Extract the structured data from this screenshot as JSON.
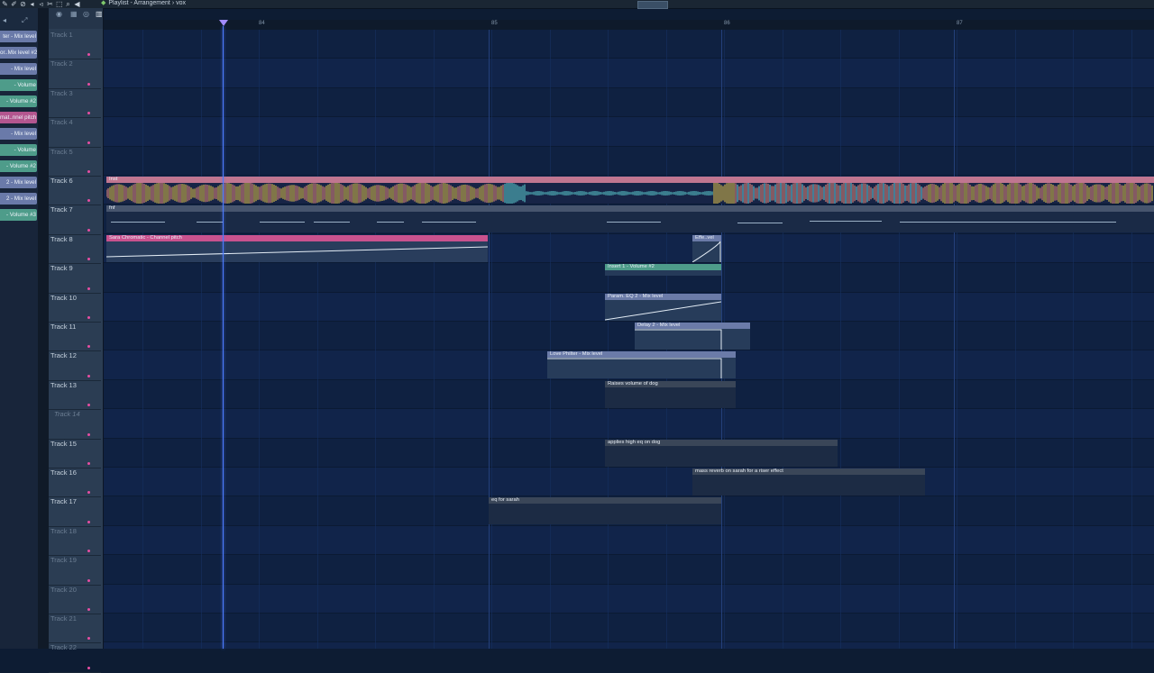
{
  "window": {
    "title": "Playlist - Arrangement",
    "separator": "›",
    "pattern": "vox"
  },
  "picker": {
    "items": [
      {
        "label": "ter - Mix level",
        "color": "blue"
      },
      {
        "label": "or..Mix level #2",
        "color": "blue"
      },
      {
        "label": "- Mix level",
        "color": "blue"
      },
      {
        "label": "- Volume",
        "color": "green"
      },
      {
        "label": "- Volume #2",
        "color": "green"
      },
      {
        "label": "mat..nnel pitch",
        "color": "pink"
      },
      {
        "label": "- Mix level",
        "color": "blue"
      },
      {
        "label": "- Volume",
        "color": "green"
      },
      {
        "label": "- Volume #2",
        "color": "green"
      },
      {
        "label": "2 - Mix level",
        "color": "blue"
      },
      {
        "label": "2 - Mix level",
        "color": "blue"
      },
      {
        "label": "- Volume #3",
        "color": "green"
      }
    ]
  },
  "ruler": {
    "bars": [
      "84",
      "85",
      "86",
      "87"
    ]
  },
  "tracks": [
    {
      "label": "Track 1",
      "style": "dim"
    },
    {
      "label": "Track 2",
      "style": "dim"
    },
    {
      "label": "Track 3",
      "style": "dim"
    },
    {
      "label": "Track 4",
      "style": "dim"
    },
    {
      "label": "Track 5",
      "style": "dim"
    },
    {
      "label": "Track 6",
      "style": "normal"
    },
    {
      "label": "Track 7",
      "style": "normal"
    },
    {
      "label": "Track 8",
      "style": "normal"
    },
    {
      "label": "Track 9",
      "style": "normal"
    },
    {
      "label": "Track 10",
      "style": "normal"
    },
    {
      "label": "Track 11",
      "style": "normal"
    },
    {
      "label": "Track 12",
      "style": "normal"
    },
    {
      "label": "Track 13",
      "style": "normal"
    },
    {
      "label": "Track 14",
      "style": "italic"
    },
    {
      "label": "Track 15",
      "style": "normal"
    },
    {
      "label": "Track 16",
      "style": "normal"
    },
    {
      "label": "Track 17",
      "style": "normal"
    },
    {
      "label": "Track 18",
      "style": "dim"
    },
    {
      "label": "Track 19",
      "style": "dim"
    },
    {
      "label": "Track 20",
      "style": "dim"
    },
    {
      "label": "Track 21",
      "style": "dim"
    },
    {
      "label": "Track 22",
      "style": "dim"
    }
  ],
  "clips": [
    {
      "name": "inst-clip",
      "label": "Inst",
      "type": "audio"
    },
    {
      "name": "fnf-clip",
      "label": "fnf",
      "type": "midi"
    },
    {
      "name": "sara-chromatic-clip",
      "label": "Sara Chromatic - Channel pitch",
      "type": "pink"
    },
    {
      "name": "effect-clip",
      "label": "Effe..vel",
      "type": "blue"
    },
    {
      "name": "insert1-volume2-clip",
      "label": "Insert 1 - Volume #2",
      "type": "green"
    },
    {
      "name": "param-eq2-clip",
      "label": "Param. EQ 2 - Mix level",
      "type": "blue"
    },
    {
      "name": "delay2-clip",
      "label": "Delay 2 - Mix level",
      "type": "blue"
    },
    {
      "name": "love-philter-clip",
      "label": "Love Philter - Mix level",
      "type": "blue"
    },
    {
      "name": "raises-volume-clip",
      "label": "Raises volume of dog",
      "type": "dark"
    },
    {
      "name": "high-eq-clip",
      "label": "applies high eq on dog",
      "type": "dark"
    },
    {
      "name": "mass-reverb-clip",
      "label": "mass reverb on sarah for a riser effect",
      "type": "dark"
    },
    {
      "name": "eq-sarah-clip",
      "label": "eq for sarah",
      "type": "dark"
    }
  ]
}
